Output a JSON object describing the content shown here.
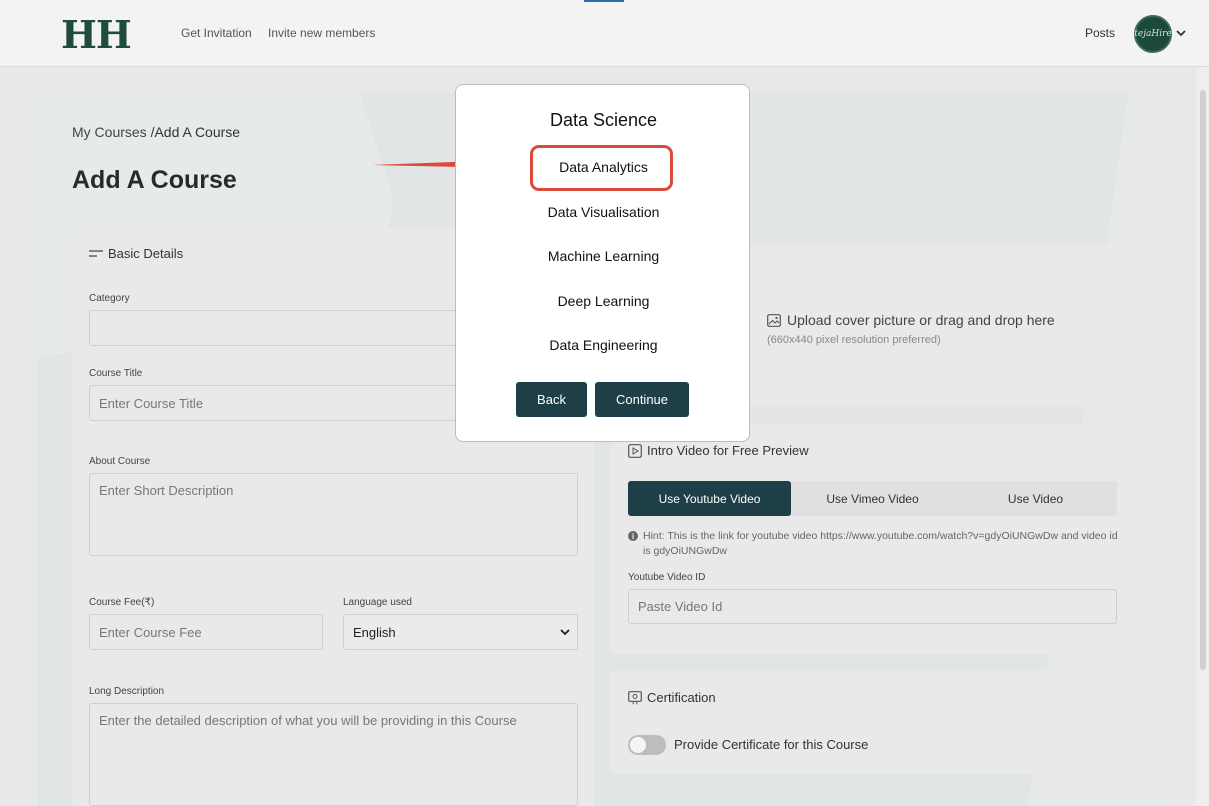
{
  "nav": {
    "logo": "HH",
    "links": [
      "Get Invitation",
      "Invite new members"
    ],
    "posts": "Posts",
    "avatar_text": "tejaHire"
  },
  "breadcrumb": {
    "parent": "My Courses",
    "sep": " /",
    "current": "Add A Course"
  },
  "page_title": "Add A Course",
  "basic": {
    "heading": "Basic Details",
    "category_label": "Category",
    "title_label": "Course Title",
    "title_placeholder": "Enter Course Title",
    "about_label": "About Course",
    "about_placeholder": "Enter Short Description",
    "fee_label": "Course Fee(₹)",
    "fee_placeholder": "Enter Course Fee",
    "lang_label": "Language used",
    "lang_value": "English",
    "long_label": "Long Description",
    "long_placeholder": "Enter the detailed description of what you will be providing in this Course"
  },
  "upload": {
    "text": "Upload cover picture or drag and drop here",
    "sub": "(660x440 pixel resolution preferred)"
  },
  "video": {
    "heading": "Intro Video for Free Preview",
    "tabs": [
      "Use Youtube Video",
      "Use Vimeo Video",
      "Use Video"
    ],
    "hint": "Hint: This is the link for youtube video https://www.youtube.com/watch?v=gdyOiUNGwDw and video id is gdyOiUNGwDw",
    "id_label": "Youtube Video ID",
    "id_placeholder": "Paste Video Id"
  },
  "cert": {
    "heading": "Certification",
    "toggle_label": "Provide Certificate for this Course"
  },
  "modal": {
    "title": "Data Science",
    "items": [
      "Data Analytics",
      "Data Visualisation",
      "Machine Learning",
      "Deep Learning",
      "Data Engineering"
    ],
    "back": "Back",
    "continue": "Continue"
  },
  "colors": {
    "accent_dark": "#1f3f48",
    "highlight": "#dc4a3a",
    "brand": "#1f4d3c"
  }
}
